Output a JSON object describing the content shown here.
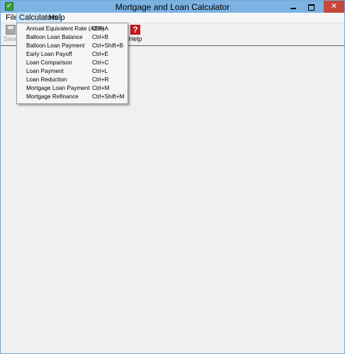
{
  "window": {
    "title": "Mortgage and Loan Calculator",
    "close_glyph": "✕",
    "app_icon_glyph": "✓"
  },
  "menubar": {
    "file": "File",
    "calculators": "Calculators",
    "help": "Help"
  },
  "toolbar": {
    "save_label": "Save",
    "help_label": "Help",
    "help_glyph": "?"
  },
  "dropdown": {
    "items": [
      {
        "label": "Annual Equivalent Rate (AER)",
        "shortcut": "Ctrl+A"
      },
      {
        "label": "Balloon Loan Balance",
        "shortcut": "Ctrl+B"
      },
      {
        "label": "Balloon Loan Payment",
        "shortcut": "Ctrl+Shift+B"
      },
      {
        "label": "Early Loan Payoff",
        "shortcut": "Ctrl+E"
      },
      {
        "label": "Loan Comparison",
        "shortcut": "Ctrl+C"
      },
      {
        "label": "Loan Payment",
        "shortcut": "Ctrl+L"
      },
      {
        "label": "Loan Reduction",
        "shortcut": "Ctrl+R"
      },
      {
        "label": "Mortgage Loan Payment",
        "shortcut": "Ctrl+M"
      },
      {
        "label": "Mortgage Refinance",
        "shortcut": "Ctrl+Shift+M"
      }
    ]
  },
  "colors": {
    "titlebar": "#7cb3e2",
    "close_button": "#c7463b",
    "help_icon": "#c4161c",
    "menu_highlight": "#cce4f7"
  }
}
